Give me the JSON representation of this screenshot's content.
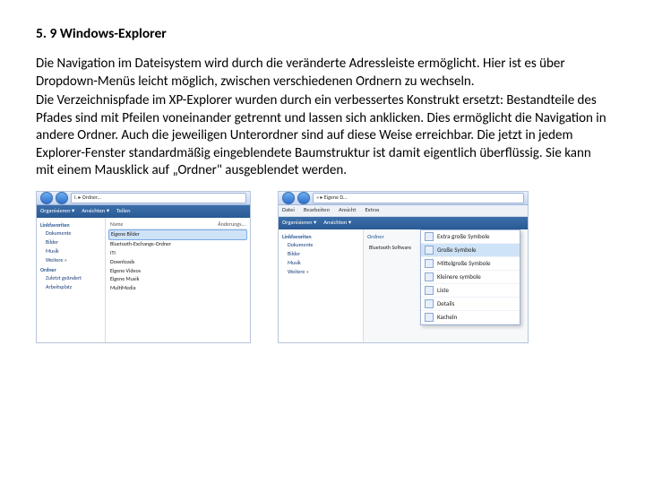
{
  "heading": "5. 9 Windows-Explorer",
  "paragraph1": "Die Navigation im Dateisystem wird durch die veränderte Adressleiste ermöglicht. Hier ist es über Dropdown-Menüs leicht möglich, zwischen verschiedenen Ordnern zu wechseln.",
  "paragraph2": "Die Verzeichnispfade im XP-Explorer wurden durch ein verbessertes Konstrukt ersetzt: Bestandteile des Pfades sind mit Pfeilen voneinander getrennt und lassen sich anklicken. Dies ermöglicht die Navigation in andere Ordner. Auch die jeweiligen Unterordner sind auf diese Weise erreichbar. Die jetzt in jedem Explorer-Fenster standardmäßig eingeblendete Baumstruktur ist damit eigentlich überflüssig. Sie kann mit einem Mausklick auf „Ordner\" ausgeblendet werden.",
  "fig1": {
    "crumbs": [
      "I. ▸ Ordner..."
    ],
    "toolbar": [
      "Organisieren ▾",
      "Ansichten ▾",
      "Teilen"
    ],
    "nav_header1": "Linkfavoriten",
    "nav_items1": [
      "Dokumente",
      "Bilder",
      "Musik",
      "Weitere »"
    ],
    "nav_header2": "Ordner",
    "nav_items2": [
      "Zuletzt geändert",
      "Arbeitsplatz"
    ],
    "list_header": [
      "Name",
      "Änderungs..."
    ],
    "list_items": [
      "Eigene Bilder",
      "Bluetooth-Exchange-Ordner",
      "ITI",
      "Downloads",
      "Eigene Videos",
      "Eigene Musik",
      "MultiMedia"
    ]
  },
  "fig2": {
    "crumbs": [
      "« ▸ Eigene D..."
    ],
    "menubar": [
      "Datei",
      "Bearbeiten",
      "Ansicht",
      "Extras"
    ],
    "toolbar": [
      "Organisieren ▾",
      "Ansichten ▾"
    ],
    "nav_header": "Linkfavoriten",
    "nav_items": [
      "Dokumente",
      "Bilder",
      "Musik",
      "Weitere »"
    ],
    "content_header": "Ordner",
    "content_item": "Bluetooth Software",
    "popup": [
      "Extra große Symbole",
      "Große Symbole",
      "Mittelgroße Symbole",
      "Kleinere symbole",
      "Liste",
      "Details",
      "Kacheln"
    ],
    "popup_selected": 1
  }
}
